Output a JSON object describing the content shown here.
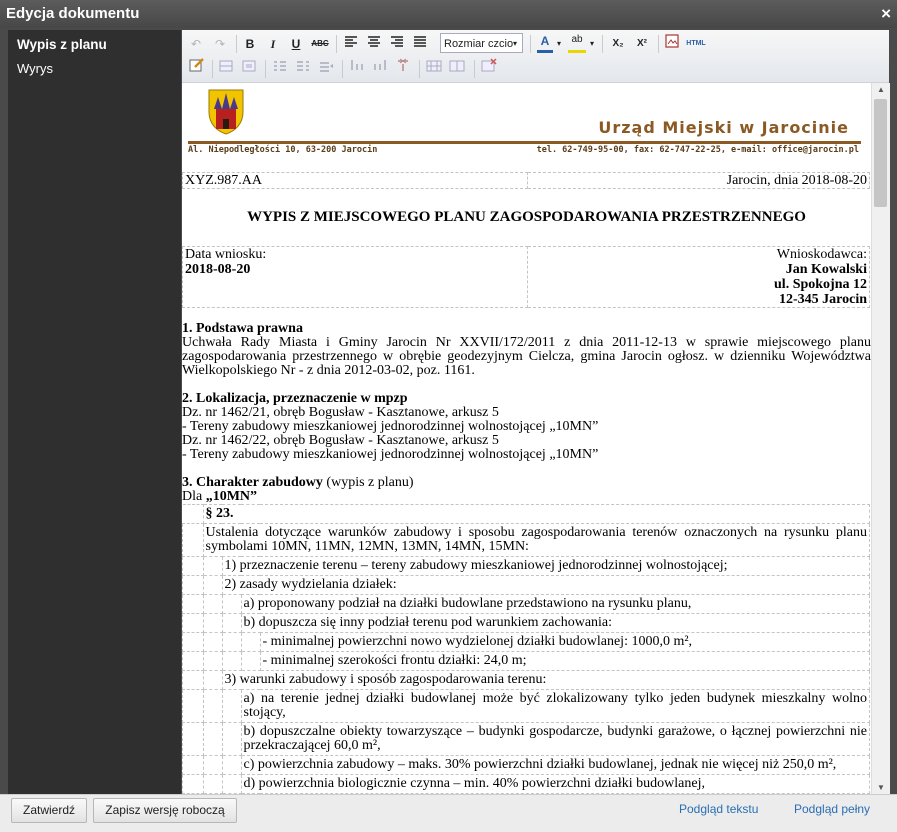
{
  "window": {
    "title": "Edycja dokumentu",
    "close_glyph": "×"
  },
  "sidebar": {
    "items": [
      {
        "label": "Wypis z planu"
      },
      {
        "label": "Wyrys"
      }
    ]
  },
  "toolbar": {
    "font_size_placeholder": "Rozmiar czcion",
    "buttons": {
      "undo": "↶",
      "redo": "↷",
      "bold": "B",
      "italic": "I",
      "underline": "U",
      "strike": "ABC",
      "subscript": "X₂",
      "superscript": "X²",
      "html": "HTML",
      "text_color": "A",
      "highlight": "ab"
    }
  },
  "doc": {
    "office_name": "Urząd Miejski w Jarocinie",
    "address": "Al. Niepodległości 10, 63-200 Jarocin",
    "contact": "tel. 62-749-95-00, fax: 62-747-22-25, e-mail: office@jarocin.pl",
    "ref_no": "XYZ.987.AA",
    "place_date": "Jarocin, dnia 2018-08-20",
    "heading": "WYPIS Z MIEJSCOWEGO PLANU ZAGOSPODAROWANIA PRZESTRZENNEGO",
    "request_date_label": "Data wniosku:",
    "request_date": "2018-08-20",
    "applicant_label": "Wnioskodawca:",
    "applicant_name": "Jan Kowalski",
    "applicant_street": "ul. Spokojna 12",
    "applicant_city": "12-345 Jarocin",
    "s1_title": "1. Podstawa prawna",
    "s1_text": "Uchwała Rady Miasta i Gminy Jarocin Nr XXVII/172/2011 z dnia 2011-12-13 w sprawie miejscowego planu zagospodarowania przestrzennego w obrębie geodezyjnym Cielcza, gmina Jarocin ogłosz. w dzienniku Województwa Wielkopolskiego Nr - z dnia 2012-03-02, poz. 1161.",
    "s2_title": "2. Lokalizacja, przeznaczenie w mpzp",
    "s2_lines": [
      "Dz. nr 1462/21, obręb Bogusław - Kasztanowe, arkusz 5",
      "- Tereny zabudowy mieszkaniowej jednorodzinnej wolnostojącej „10MN”",
      "Dz. nr 1462/22, obręb Bogusław - Kasztanowe, arkusz 5",
      "- Tereny zabudowy mieszkaniowej jednorodzinnej wolnostojącej „10MN”"
    ],
    "s3_title": "3. Charakter zabudowy",
    "s3_suffix": " (wypis z planu)",
    "s3_for": "Dla ",
    "s3_symbol": "„10MN”",
    "para": "§ 23.",
    "rows": [
      "Ustalenia dotyczące warunków zabudowy i sposobu zagospodarowania terenów oznaczonych na rysunku planu symbolami 10MN, 11MN, 12MN, 13MN, 14MN, 15MN:",
      "1) przeznaczenie terenu – tereny zabudowy mieszkaniowej jednorodzinnej wolnostojącej;",
      "2) zasady wydzielania działek:",
      "a) proponowany podział na działki budowlane przedstawiono na rysunku planu,",
      "b) dopuszcza się inny podział terenu pod warunkiem zachowania:",
      "- minimalnej powierzchni nowo wydzielonej działki budowlanej: 1000,0 m²,",
      "- minimalnej szerokości frontu działki: 24,0 m;",
      "3) warunki zabudowy i sposób zagospodarowania terenu:",
      "a) na terenie jednej działki budowlanej może być zlokalizowany tylko jeden budynek mieszkalny wolno stojący,",
      "b) dopuszczalne obiekty towarzyszące – budynki gospodarcze, budynki garażowe, o łącznej powierzchni nie przekraczającej 60,0 m²,",
      "c) powierzchnia zabudowy – maks. 30% powierzchni działki budowlanej, jednak nie więcej niż 250,0 m²,",
      "d) powierzchnia biologicznie czynna – min. 40% powierzchni działki budowlanej,"
    ]
  },
  "footer": {
    "confirm": "Zatwierdź",
    "save_draft": "Zapisz wersję roboczą",
    "preview_text": "Podgląd tekstu",
    "preview_full": "Podgląd pełny"
  }
}
